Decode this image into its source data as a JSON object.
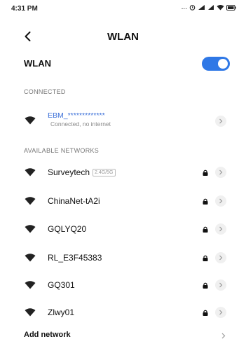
{
  "status_bar": {
    "time": "4:31 PM",
    "icons": [
      "more-dots-icon",
      "alarm-icon",
      "signal-4g-icon",
      "signal-icon",
      "wifi-icon",
      "battery-icon"
    ],
    "more_dots": "..."
  },
  "header": {
    "title": "WLAN",
    "back_icon": "chevron-left-icon"
  },
  "wlan_toggle": {
    "label": "WLAN",
    "enabled": true,
    "accent_color": "#2f78e6"
  },
  "connected": {
    "section_label": "CONNECTED",
    "network": {
      "name": "EBM_*************",
      "status": "Connected, no internet",
      "name_color": "#3a6fd8"
    }
  },
  "available": {
    "section_label": "AVAILABLE NETWORKS",
    "networks": [
      {
        "name": "Surveytech",
        "tag": "2.4G/5G",
        "secured": true
      },
      {
        "name": "ChinaNet-tA2i",
        "secured": true
      },
      {
        "name": "GQLYQ20",
        "secured": true
      },
      {
        "name": "RL_E3F45383",
        "secured": true
      },
      {
        "name": "GQ301",
        "secured": true
      },
      {
        "name": "Zlwy01",
        "secured": true
      }
    ]
  },
  "add_network": {
    "label": "Add network"
  }
}
